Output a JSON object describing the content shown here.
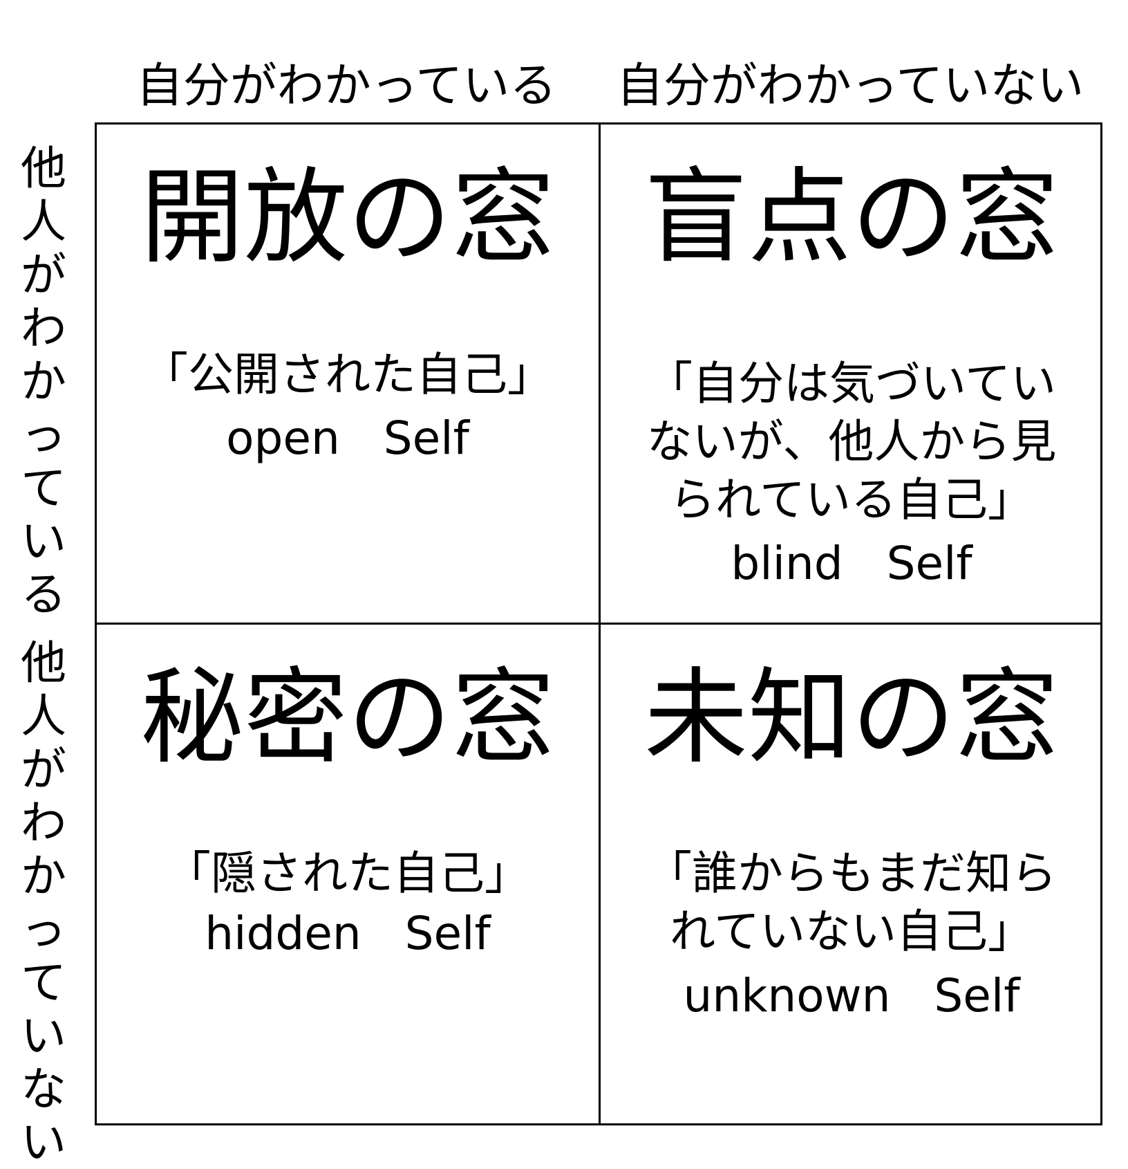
{
  "headers": {
    "col_left": "自分がわかっている",
    "col_right": "自分がわかっていない",
    "row_top": "他人がわかっている",
    "row_bottom": "他人がわかっていない"
  },
  "windows": {
    "open": {
      "title": "開放の窓",
      "description": "「公開された自己」",
      "english": "open   Self"
    },
    "blind": {
      "title": "盲点の窓",
      "description": "「自分は気づいていないが、他人から見られている自己」",
      "english": "blind   Self"
    },
    "hidden": {
      "title": "秘密の窓",
      "description": "「隠された自己」",
      "english": "hidden   Self"
    },
    "unknown": {
      "title": "未知の窓",
      "description": "「誰からもまだ知られていない自己」",
      "english": "unknown   Self"
    }
  }
}
